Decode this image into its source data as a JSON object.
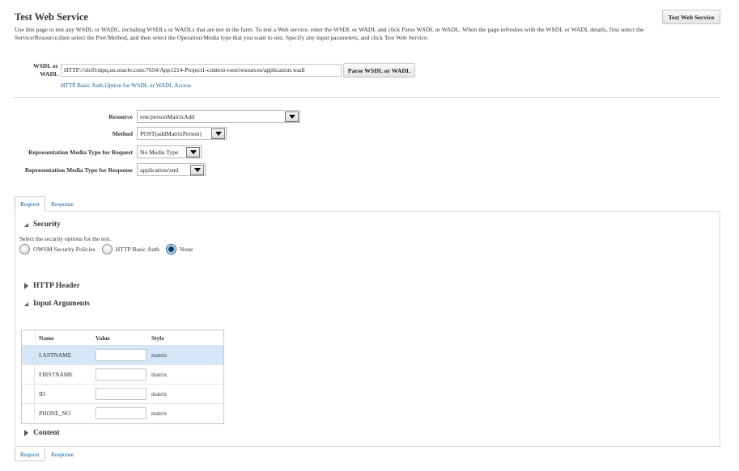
{
  "page": {
    "title": "Test Web Service",
    "description": "Use this page to test any WSDL or WADL, including WSDLs or WADLs that are not in the farm. To test a Web service, enter the WSDL or WADL and click Parse WSDL or WADL. When the page refreshes with the WSDL or WADL details, first select the Service/Resource,then select the Port/Method, and then select the Operation/Media type that you want to test. Specify any input parameters, and click Test Web Service.",
    "test_button": "Test Web Service"
  },
  "wsdl": {
    "label": "WSDL or WADL",
    "value": "HTTP://slc01mpq.us.oracle.com:7654/App1214-Project1-context-root/resources/application.wadl",
    "parse_button": "Parse WSDL or WADL",
    "auth_link": "HTTP Basic Auth Option for WSDL or WADL Access"
  },
  "form": {
    "resource_label": "Resource",
    "resource_value": "rest/personMatrixAdd",
    "method_label": "Method",
    "method_value": "POST(addMatrixPerson)",
    "req_media_label": "Representation Media Type for Request",
    "req_media_value": "No Media Type",
    "resp_media_label": "Representation Media Type for Response",
    "resp_media_value": "application/xml"
  },
  "tabs": {
    "request": "Request",
    "response": "Response"
  },
  "security": {
    "heading": "Security",
    "hint": "Select the security options for the test.",
    "options": [
      "OWSM Security Policies",
      "HTTP Basic Auth",
      "None"
    ],
    "selected": "None"
  },
  "sections": {
    "http_header": "HTTP Header",
    "input_arguments": "Input Arguments",
    "content": "Content"
  },
  "args_table": {
    "columns": [
      "Name",
      "Value",
      "Style"
    ],
    "rows": [
      {
        "name": "LASTNAME",
        "value": "",
        "style": "matrix"
      },
      {
        "name": "FIRSTNAME",
        "value": "",
        "style": "matrix"
      },
      {
        "name": "ID",
        "value": "",
        "style": "matrix"
      },
      {
        "name": "PHONE_NO",
        "value": "",
        "style": "matrix"
      }
    ]
  },
  "colors": {
    "link": "#145c9e",
    "selected_row": "#d4e6f7",
    "panel_border": "#d6d6d6"
  }
}
